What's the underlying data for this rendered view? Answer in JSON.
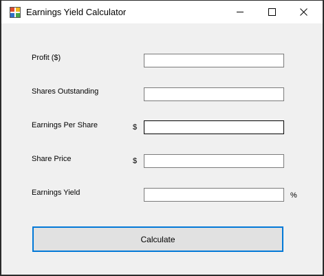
{
  "window": {
    "title": "Earnings Yield Calculator"
  },
  "form": {
    "profit": {
      "label": "Profit ($)",
      "value": ""
    },
    "shares_outstanding": {
      "label": "Shares Outstanding",
      "value": ""
    },
    "earnings_per_share": {
      "label": "Earnings Per Share",
      "prefix": "$",
      "value": ""
    },
    "share_price": {
      "label": "Share Price",
      "prefix": "$",
      "value": ""
    },
    "earnings_yield": {
      "label": "Earnings Yield",
      "suffix": "%",
      "value": ""
    }
  },
  "actions": {
    "calculate_label": "Calculate"
  },
  "colors": {
    "window_bg": "#f0f0f0",
    "titlebar_bg": "#ffffff",
    "button_focus_border": "#0078d7",
    "button_bg": "#e1e1e1"
  }
}
